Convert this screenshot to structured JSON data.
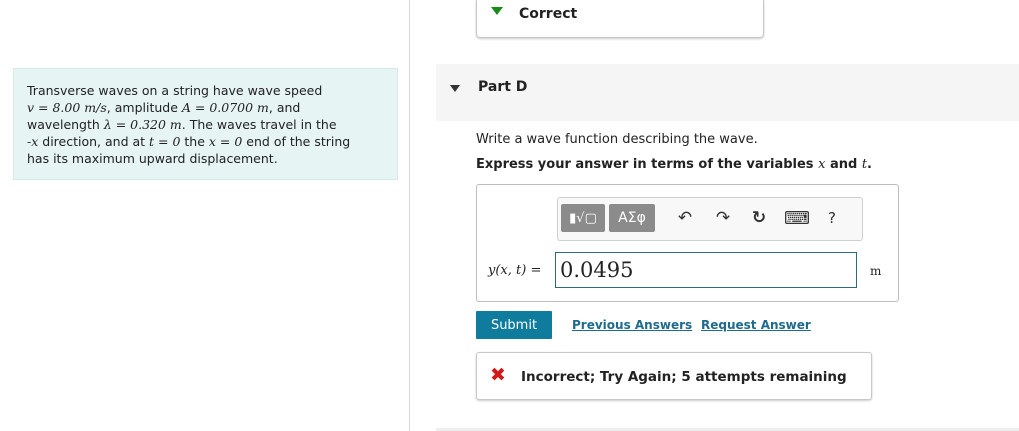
{
  "problem": {
    "line1": "Transverse waves on a string have wave speed",
    "line2_math1": "v = 8.00 m/s",
    "line2_text": ", amplitude ",
    "line2_math2": "A = 0.0700 m",
    "line2_tail": ", and",
    "line3_text": "wavelength ",
    "line3_math": "λ = 0.320 m",
    "line3_tail": ". The waves travel in the",
    "line4_math1": "-x",
    "line4_text1": " direction, and at ",
    "line4_math2": "t = 0",
    "line4_text2": " the ",
    "line4_math3": "x = 0",
    "line4_text3": " end of the string",
    "line5": "has its maximum upward displacement."
  },
  "previous_part": {
    "status": "Correct"
  },
  "part": {
    "title": "Part D",
    "prompt": "Write a wave function describing the wave.",
    "instruction_prefix": "Express your answer in terms of the variables ",
    "var_x": "x",
    "instruction_and": " and ",
    "var_t": "t",
    "instruction_suffix": "."
  },
  "toolbar": {
    "templates_label": "▮√▢",
    "greek_label": "ΑΣφ",
    "undo_icon": "↶",
    "redo_icon": "↷",
    "reset_icon": "↻",
    "keyboard_icon": "⌨",
    "help_icon": "?"
  },
  "answer": {
    "lhs": "y(x, t) =",
    "value": "0.0495",
    "unit": "m"
  },
  "actions": {
    "submit": "Submit",
    "previous_answers": "Previous Answers",
    "request_answer": "Request Answer"
  },
  "feedback": {
    "message": "Incorrect; Try Again; 5 attempts remaining"
  },
  "colors": {
    "accent": "#0f7c9e",
    "correct": "#1a8a1a",
    "incorrect": "#d41818",
    "problem_bg": "#e6f4f4"
  }
}
